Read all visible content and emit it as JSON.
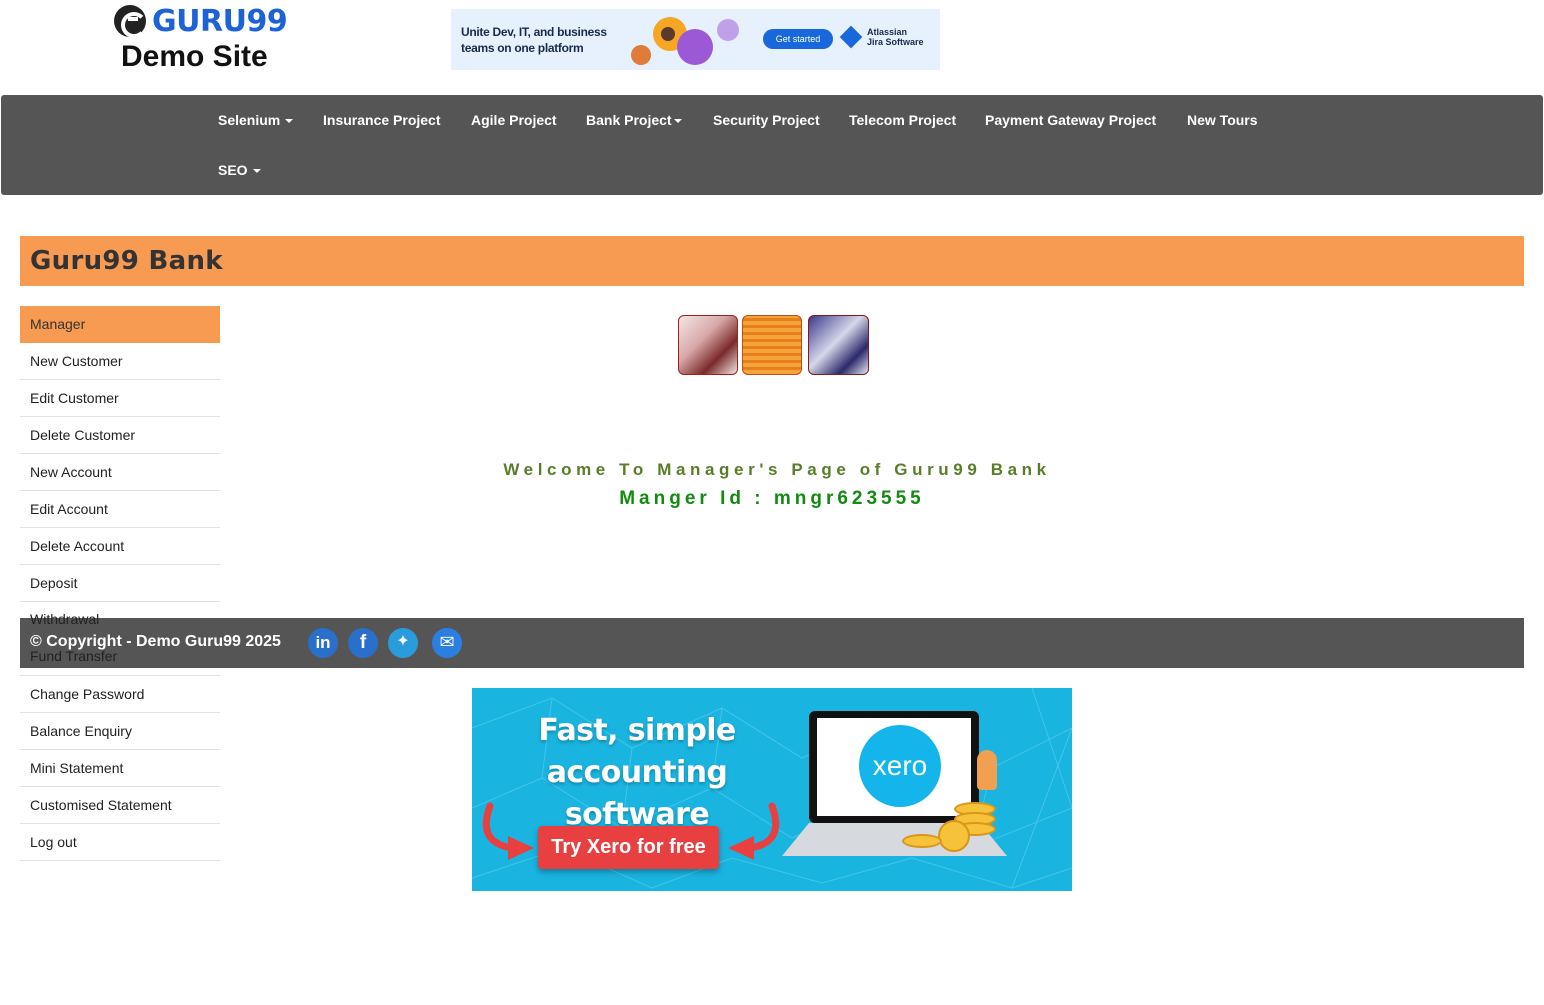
{
  "header": {
    "logo_text": "GURU99",
    "logo_sub": "Demo Site"
  },
  "top_ad": {
    "headline": "Unite Dev, IT, and business teams on one platform",
    "button": "Get started",
    "brand_line1": "Atlassian",
    "brand_line2": "Jira Software"
  },
  "nav": {
    "items": [
      {
        "label": "Selenium",
        "dropdown": true
      },
      {
        "label": "Insurance Project",
        "dropdown": false
      },
      {
        "label": "Agile Project",
        "dropdown": false
      },
      {
        "label": "Bank Project",
        "dropdown": true
      },
      {
        "label": "Security Project",
        "dropdown": false
      },
      {
        "label": "Telecom Project",
        "dropdown": false
      },
      {
        "label": "Payment Gateway Project",
        "dropdown": false
      },
      {
        "label": "New Tours",
        "dropdown": false
      },
      {
        "label": "SEO",
        "dropdown": true
      }
    ]
  },
  "bank": {
    "title": "Guru99 Bank"
  },
  "sidebar": {
    "items": [
      {
        "label": "Manager",
        "active": true
      },
      {
        "label": "New Customer"
      },
      {
        "label": "Edit Customer"
      },
      {
        "label": "Delete Customer"
      },
      {
        "label": "New Account"
      },
      {
        "label": "Edit Account"
      },
      {
        "label": "Delete Account"
      },
      {
        "label": "Deposit"
      },
      {
        "label": "Withdrawal"
      },
      {
        "label": "Fund Transfer"
      },
      {
        "label": "Change Password"
      },
      {
        "label": "Balance Enquiry"
      },
      {
        "label": "Mini Statement"
      },
      {
        "label": "Customised Statement"
      },
      {
        "label": "Log out"
      }
    ]
  },
  "main": {
    "welcome": "Welcome To Manager's Page of Guru99 Bank",
    "manager_id": "Manger Id : mngr623555"
  },
  "footer": {
    "copyright": "© Copyright - Demo Guru99 2025",
    "social": [
      "linkedin-icon",
      "facebook-icon",
      "twitter-icon",
      "email-icon"
    ]
  },
  "xero_ad": {
    "headline_line1": "Fast, simple",
    "headline_line2": "accounting software",
    "button": "Try Xero for free",
    "logo": "xero"
  },
  "colors": {
    "accent_orange": "#f79a52",
    "nav_gray": "#555555",
    "welcome_green": "#5a7d2a",
    "id_green": "#138a10"
  }
}
